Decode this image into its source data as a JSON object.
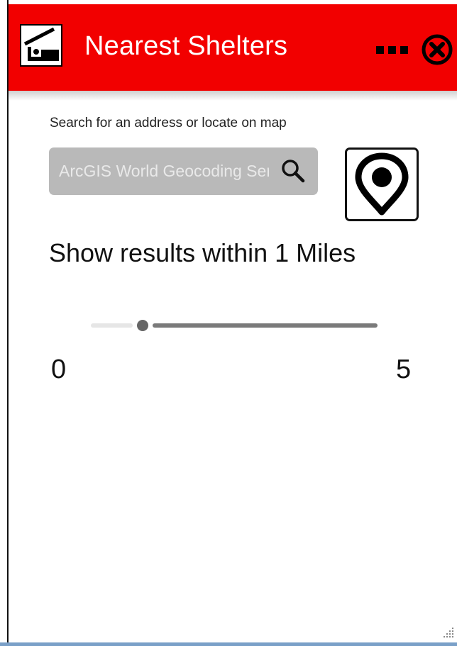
{
  "header": {
    "title": "Nearest Shelters",
    "logo_icon": "shelter-icon",
    "menu_icon": "ellipsis-icon",
    "close_icon": "close-circle-icon",
    "bg_color": "#f20000"
  },
  "search": {
    "label": "Search for an address or locate on map",
    "placeholder": "ArcGIS World Geocoding Service",
    "value": "",
    "icon": "search-icon"
  },
  "locate": {
    "icon": "map-pin-icon"
  },
  "radius": {
    "text": "Show results within 1 Miles",
    "slider_min": "0",
    "slider_max": "5",
    "slider_value": 1
  }
}
